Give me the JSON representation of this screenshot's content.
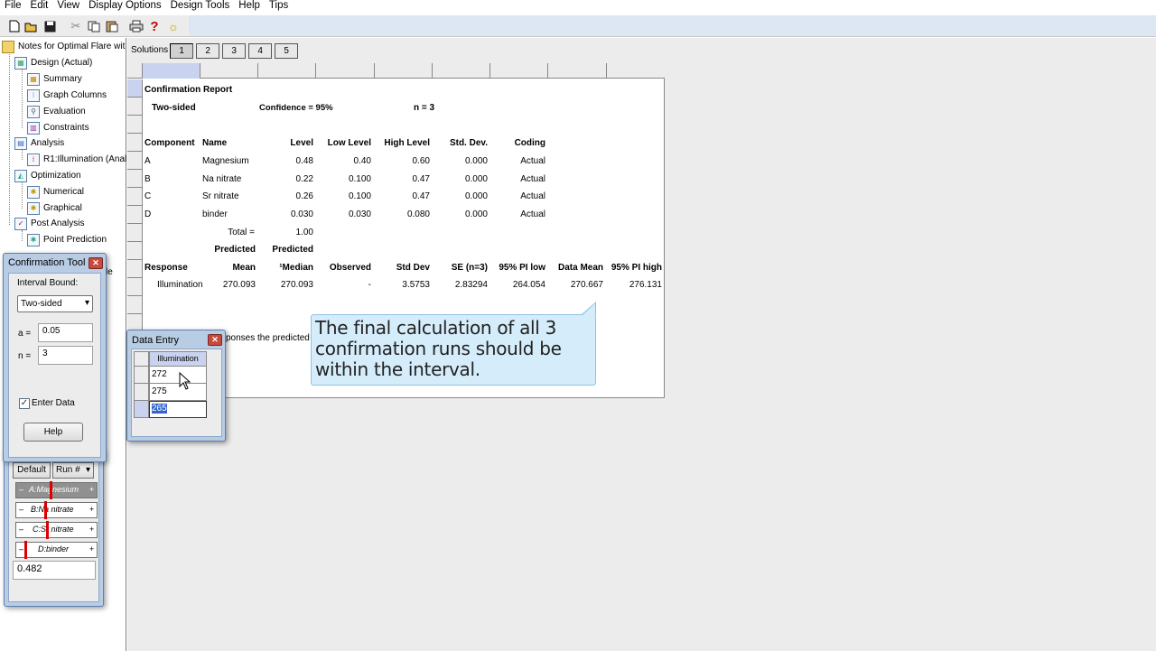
{
  "menu": [
    "File",
    "Edit",
    "View",
    "Display Options",
    "Design Tools",
    "Help",
    "Tips"
  ],
  "tree": {
    "root": "Notes for Optimal Flare wit",
    "items": [
      {
        "label": "Design (Actual)",
        "level": 1
      },
      {
        "label": "Summary",
        "level": 2
      },
      {
        "label": "Graph Columns",
        "level": 2
      },
      {
        "label": "Evaluation",
        "level": 2
      },
      {
        "label": "Constraints",
        "level": 2
      },
      {
        "label": "Analysis",
        "level": 1
      },
      {
        "label": "R1:Illumination (Anal",
        "level": 2
      },
      {
        "label": "Optimization",
        "level": 1
      },
      {
        "label": "Numerical",
        "level": 2
      },
      {
        "label": "Graphical",
        "level": 2
      },
      {
        "label": "Post Analysis",
        "level": 1
      },
      {
        "label": "Point Prediction",
        "level": 2
      }
    ],
    "partial_label": "le"
  },
  "solutions": {
    "label": "Solutions",
    "tabs": [
      "1",
      "2",
      "3",
      "4",
      "5"
    ],
    "active": "1"
  },
  "report": {
    "title": "Confirmation Report",
    "sided": "Two-sided",
    "confidence": "Confidence = 95%",
    "n": "n =  3",
    "component_headers": [
      "Component",
      "Name",
      "Level",
      "Low Level",
      "High Level",
      "Std. Dev.",
      "Coding"
    ],
    "components": [
      [
        "A",
        "Magnesium",
        "0.48",
        "0.40",
        "0.60",
        "0.000",
        "Actual"
      ],
      [
        "B",
        "Na nitrate",
        "0.22",
        "0.100",
        "0.47",
        "0.000",
        "Actual"
      ],
      [
        "C",
        "Sr nitrate",
        "0.26",
        "0.100",
        "0.47",
        "0.000",
        "Actual"
      ],
      [
        "D",
        "binder",
        "0.030",
        "0.030",
        "0.080",
        "0.000",
        "Actual"
      ]
    ],
    "total_label": "Total =",
    "total_value": "1.00",
    "predicted1": "Predicted",
    "predicted2": "Predicted",
    "response_headers": [
      "Response",
      "Mean",
      "¹Median",
      "Observed",
      "Std Dev",
      "SE (n=3)",
      "95% PI low",
      "Data Mean",
      "95% PI high"
    ],
    "response_row": [
      "Illumination",
      "270.093",
      "270.093",
      "-",
      "3.5753",
      "2.83294",
      "264.054",
      "270.667",
      "276.131"
    ],
    "note_fragment": "ponses the predicted"
  },
  "callout": "The final calculation of all 3 confirmation runs should be within the interval.",
  "confirmation_tool": {
    "title": "Confirmation Tool",
    "interval_label": "Interval Bound:",
    "interval_value": "Two-sided",
    "a_label": "a =",
    "a_value": "0.05",
    "n_label": "n =",
    "n_value": "3",
    "enter_data_label": "Enter Data",
    "enter_data_checked": true,
    "help_label": "Help"
  },
  "data_entry": {
    "title": "Data Entry",
    "column": "Illumination",
    "values": [
      "272",
      "275",
      "265"
    ]
  },
  "factors_panel": {
    "default_label": "Default",
    "run_label": "Run #",
    "sliders": [
      "A:Magnesium",
      "B:Na nitrate",
      "C:Sr nitrate",
      "D:binder"
    ],
    "value": "0.482"
  },
  "colors": {
    "selection": "#3366cc",
    "callout_bg": "#d5edfb",
    "window_frame": "#b8cce4",
    "close": "#c74a3b"
  }
}
